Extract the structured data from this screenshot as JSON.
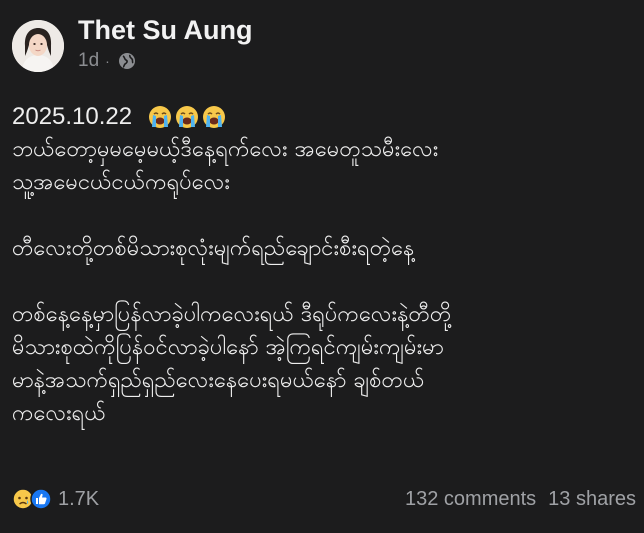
{
  "post": {
    "author": "Thet Su Aung",
    "time": "1d",
    "separator": "·",
    "privacy_icon": "globe-icon",
    "date_text": "2025.10.22",
    "emojis": [
      "loudly-crying-face",
      "loudly-crying-face",
      "loudly-crying-face"
    ],
    "lines": [
      "ဘယ်တော့မှမမေ့မယ့်ဒီနေ့ရက်လေး  အမေတူသမီးလေး",
      "သူ့အမေငယ်ငယ်ကရုပ်လေး",
      "",
      "တီလေးတို့တစ်မိသားစုလုံးမျက်ရည်ချောင်းစီးရတဲ့နေ့",
      "",
      "တစ်နေ့နေ့မှာပြန်လာခဲ့ပါကလေးရယ်  ဒီရုပ်ကလေးနဲ့တီတို့",
      "မိသားစုထဲကိုပြန်ဝင်လာခဲ့ပါနော်  အဲ့ကြရင်ကျမ်းကျမ်းမာ",
      "မာနဲ့အသက်ရှည်ရှည်လေးနေပေးရမယ်နော်  ချစ်တယ်",
      "ကလေးရယ်"
    ],
    "reactions": {
      "icons": [
        "sad-reaction-icon",
        "like-reaction-icon"
      ],
      "count": "1.7K"
    },
    "comments": "132 comments",
    "shares": "13 shares"
  },
  "colors": {
    "background": "#1c1c1d",
    "text": "#eeeeee",
    "muted": "#9fa1a5",
    "like_blue": "#1877f2",
    "sad_yellow": "#f7c84a"
  }
}
